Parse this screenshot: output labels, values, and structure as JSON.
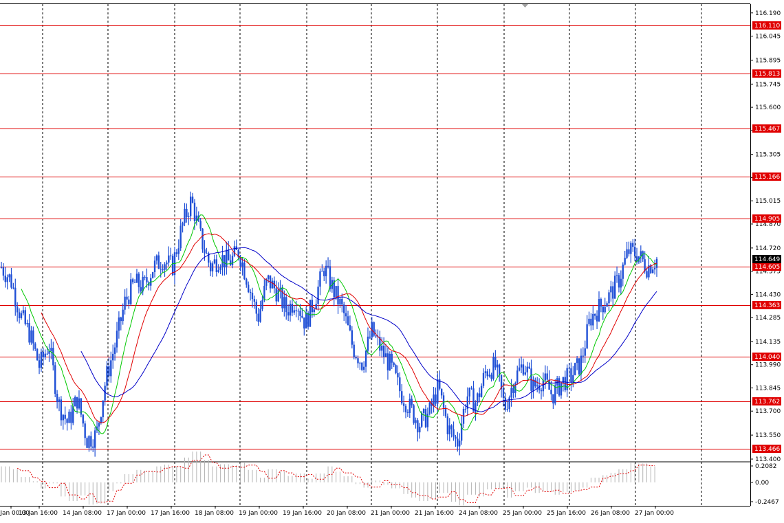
{
  "chart_data": {
    "type": "candlestick",
    "price_axis": {
      "min": 113.4,
      "max": 116.245,
      "ticks": [
        "116.190",
        "116.045",
        "115.895",
        "115.745",
        "115.600",
        "115.455",
        "115.305",
        "115.160",
        "115.015",
        "114.870",
        "114.720",
        "114.575",
        "114.430",
        "114.285",
        "114.135",
        "113.990",
        "113.845",
        "113.700",
        "113.550",
        "113.400"
      ]
    },
    "time_axis": {
      "labels": [
        "13 Jan 00:00",
        "13 Jan 16:00",
        "14 Jan 08:00",
        "17 Jan 00:00",
        "17 Jan 16:00",
        "18 Jan 08:00",
        "19 Jan 00:00",
        "19 Jan 16:00",
        "20 Jan 08:00",
        "21 Jan 00:00",
        "21 Jan 16:00",
        "24 Jan 08:00",
        "25 Jan 00:00",
        "25 Jan 16:00",
        "26 Jan 08:00",
        "27 Jan 00:00"
      ]
    },
    "horizontal_levels": [
      {
        "value": 116.11,
        "label": "116.110"
      },
      {
        "value": 115.813,
        "label": "115.813"
      },
      {
        "value": 115.467,
        "label": "115.467"
      },
      {
        "value": 115.166,
        "label": "115.166"
      },
      {
        "value": 114.905,
        "label": "114.905"
      },
      {
        "value": 114.605,
        "label": "114.605"
      },
      {
        "value": 114.363,
        "label": "114.363"
      },
      {
        "value": 114.04,
        "label": "114.040"
      },
      {
        "value": 113.762,
        "label": "113.762"
      },
      {
        "value": 113.466,
        "label": "113.466"
      }
    ],
    "current_price": {
      "value": 114.649,
      "label": "114.649"
    },
    "price_path": [
      114.6,
      114.52,
      114.3,
      114.18,
      113.98,
      114.12,
      113.75,
      113.62,
      113.78,
      113.52,
      113.55,
      113.9,
      114.12,
      114.38,
      114.5,
      114.48,
      114.6,
      114.65,
      114.6,
      114.85,
      115.02,
      114.78,
      114.6,
      114.66,
      114.63,
      114.7,
      114.5,
      114.28,
      114.52,
      114.45,
      114.33,
      114.4,
      114.25,
      114.4,
      114.6,
      114.45,
      114.32,
      114.1,
      114.0,
      114.2,
      114.08,
      113.98,
      113.82,
      113.72,
      113.62,
      113.68,
      113.85,
      113.6,
      113.5,
      113.8,
      113.75,
      113.95,
      113.98,
      113.72,
      113.9,
      114.0,
      113.85,
      113.9,
      113.8,
      113.88,
      113.92,
      114.0,
      114.28,
      114.35,
      114.42,
      114.52,
      114.7,
      114.68,
      114.6,
      114.65
    ],
    "moving_averages": [
      {
        "color": "#00c800",
        "period": 10
      },
      {
        "color": "#e00000",
        "period": 20
      },
      {
        "color": "#0000c8",
        "period": 40
      }
    ],
    "oscillator": {
      "ticks": [
        "0.2082",
        "0.00",
        "-0.2467"
      ],
      "min": -0.2467,
      "max": 0.2082
    }
  }
}
